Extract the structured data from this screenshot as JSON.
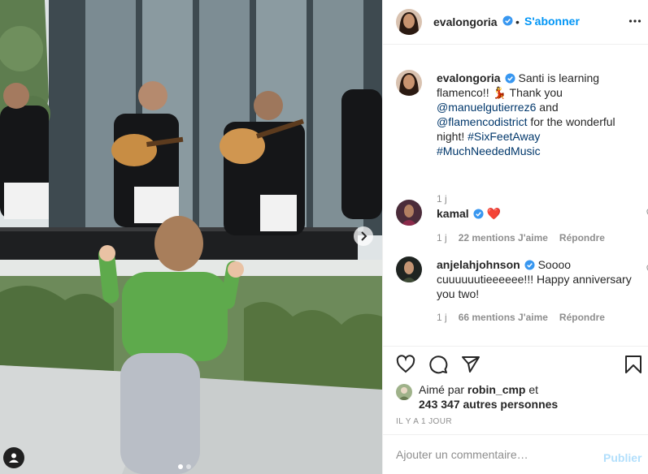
{
  "post": {
    "author": "evalongoria",
    "follow_label": "S'abonner",
    "separator": "•",
    "more_icon": "more-horizontal-icon",
    "caption": {
      "username": "evalongoria",
      "text_1": "Santi is learning flamenco!! 💃 Thank you ",
      "mention_1": "@manuelgutierrez6",
      "text_2": " and ",
      "mention_2": "@flamencodistrict",
      "text_3": " for the wonderful night! ",
      "hashtag_1": "#SixFeetAway",
      "hashtag_2": "#MuchNeededMusic",
      "time": "1 j"
    },
    "comments": [
      {
        "username": "kamal",
        "text": "❤️",
        "time": "1 j",
        "likes": "22 mentions J'aime",
        "reply": "Répondre"
      },
      {
        "username": "anjelahjohnson",
        "text": "Soooo cuuuuuutieeeeee!!! Happy anniversary you two!",
        "time": "1 j",
        "likes": "66 mentions J'aime",
        "reply": "Répondre"
      }
    ],
    "liked_by": {
      "prefix": "Aimé par ",
      "user": "robin_cmp",
      "mid": " et",
      "others": "243 347 autres personnes"
    },
    "timestamp": "IL Y A 1 JOUR",
    "comment_placeholder": "Ajouter un commentaire…",
    "publish_label": "Publier",
    "carousel": {
      "slides": 2,
      "current": 1
    }
  },
  "colors": {
    "accent": "#0095f6",
    "publish_disabled": "#b2dffc",
    "verified": "#3897f0",
    "meta": "#8e8e8e",
    "mention": "#00376b"
  }
}
